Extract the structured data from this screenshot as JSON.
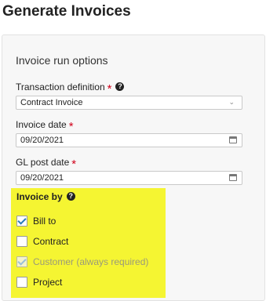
{
  "page": {
    "title": "Generate Invoices"
  },
  "section": {
    "title": "Invoice run options"
  },
  "fields": {
    "transaction_definition": {
      "label": "Transaction definition",
      "required_mark": "*",
      "value": "Contract Invoice"
    },
    "invoice_date": {
      "label": "Invoice date",
      "required_mark": "*",
      "value": "09/20/2021"
    },
    "gl_post_date": {
      "label": "GL post date",
      "required_mark": "*",
      "value": "09/20/2021"
    }
  },
  "invoice_by": {
    "label": "Invoice by",
    "options": [
      {
        "label": "Bill to",
        "checked": true,
        "disabled": false
      },
      {
        "label": "Contract",
        "checked": false,
        "disabled": false
      },
      {
        "label": "Customer (always required)",
        "checked": true,
        "disabled": true
      },
      {
        "label": "Project",
        "checked": false,
        "disabled": false
      }
    ]
  },
  "icons": {
    "help": "question-circle-icon",
    "calendar": "calendar-icon",
    "caret": "chevron-down-icon"
  },
  "colors": {
    "required": "#d0021b",
    "highlight": "#f5f532",
    "check": "#2b7bb9"
  }
}
